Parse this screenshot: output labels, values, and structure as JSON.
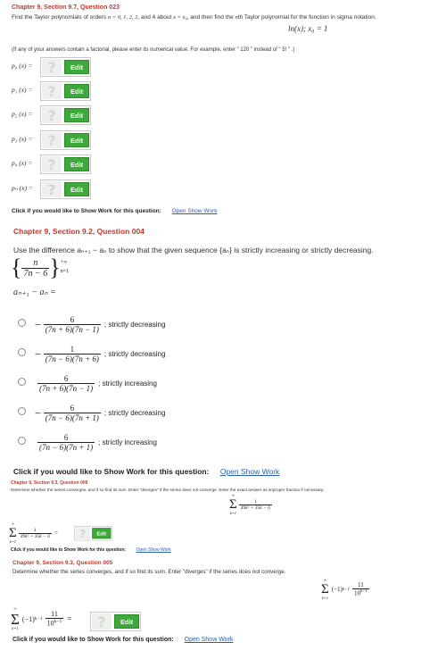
{
  "q1": {
    "heading": "Chapter 9, Section 9.7, Question 023",
    "prompt_pre": "Find the Taylor polynomials of orders",
    "orders": "n = 0, 1, 2, 3,",
    "prompt_mid": "and 4 about",
    "about": "x = x₀,",
    "prompt_post": "and then find the",
    "nth": "n",
    "prompt_end": "th Taylor polynomial for the function in sigma notation.",
    "function": "ln(x);  x₀ = 1",
    "note": "(If any of your answers contain a factorial, please enter its numerical value. For example, enter \" 120 \" instead of \" 5! \" .)",
    "rows": [
      {
        "label": "p₀ (x) ="
      },
      {
        "label": "p₁ (x) ="
      },
      {
        "label": "p₂ (x) ="
      },
      {
        "label": "p₃ (x) ="
      },
      {
        "label": "p₄ (x) ="
      },
      {
        "label": "pₙ (x) ="
      }
    ],
    "show_work": "Click if you would like to Show Work for this question:",
    "show_work_link": "Open Show Work"
  },
  "q2": {
    "heading": "Chapter 9, Section 9.2, Question 004",
    "prompt": "Use the difference aₙ₊₁ − aₙ to show that the given sequence {aₙ} is strictly increasing or strictly decreasing.",
    "seq_num": "n",
    "seq_den": "7n − 6",
    "seq_sup": "+∞",
    "seq_sub": "n=1",
    "diff_label": "aₙ₊₁ − aₙ =",
    "choices": [
      {
        "sign": "−",
        "num": "6",
        "den": "(7n + 6)(7n − 1)",
        "text": "; strictly decreasing"
      },
      {
        "sign": "−",
        "num": "1",
        "den": "(7n − 6)(7n + 6)",
        "text": "; strictly decreasing"
      },
      {
        "sign": "",
        "num": "6",
        "den": "(7n + 6)(7n − 1)",
        "text": "; strictly increasing"
      },
      {
        "sign": "−",
        "num": "6",
        "den": "(7n − 6)(7n + 1)",
        "text": "; strictly decreasing"
      },
      {
        "sign": "",
        "num": "6",
        "den": "(7n − 6)(7n + 1)",
        "text": "; strictly increasing"
      }
    ],
    "show_work": "Click if you would like to Show Work for this question:",
    "show_work_link": "Open Show Work"
  },
  "q3": {
    "heading": "Chapter 9, Section 9.3, Question 009",
    "prompt": "Determine whether the series converges, and if so find its sum. Enter \"diverges\" if the series does not converge. Enter the exact answer as improper fraction if necessary.",
    "sum_top": "∞",
    "sum_bottom": "k=1",
    "num": "1",
    "den": "49k² + 35k − 6",
    "equals": "=",
    "show_work": "Click if you would like to Show Work for this question:",
    "show_work_link": "Open Show Work"
  },
  "q4": {
    "heading": "Chapter 9, Section 9.3, Question 005",
    "prompt": "Determine whether the series converges, and if so find its sum. Enter \"diverges\" if the series does not converge.",
    "sum_top": "∞",
    "sum_bottom": "k=1",
    "sign_term": "(−1)",
    "sign_exp": "k−1",
    "num": "11",
    "den_base": "10",
    "den_exp": "k−1",
    "equals": "=",
    "show_work": "Click if you would like to Show Work for this question:",
    "show_work_link": "Open Show Work"
  },
  "ui": {
    "edit_label": "Edit",
    "qmark": "?"
  },
  "colors": {
    "heading": "#c0392b",
    "edit_button": "#3fa83b",
    "link": "#2a5db0"
  }
}
